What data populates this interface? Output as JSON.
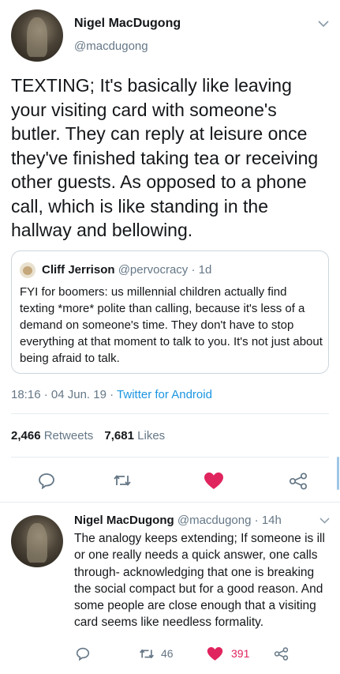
{
  "main_tweet": {
    "display_name": "Nigel MacDugong",
    "handle": "@macdugong",
    "text": "TEXTING; It's basically like leaving your visiting card with someone's butler. They can reply at leisure once they've finished taking tea or receiving other guests. As opposed to a phone call, which is like standing in the hallway and bellowing.",
    "quoted": {
      "display_name": "Cliff Jerrison",
      "handle": "@pervocracy",
      "sep": "·",
      "time": "1d",
      "text": "FYI for boomers: us millennial children actually find texting *more* polite than calling, because it's less of a demand on someone's time. They don't have to stop everything at that moment to talk to you.  It's not just about being afraid to talk."
    },
    "time": "18:16",
    "sep1": "·",
    "date": "04 Jun. 19",
    "sep2": "·",
    "client": "Twitter for Android",
    "retweets_count": "2,466",
    "retweets_label": "Retweets",
    "likes_count": "7,681",
    "likes_label": "Likes",
    "liked": true
  },
  "reply": {
    "display_name": "Nigel MacDugong",
    "handle": "@macdugong",
    "sep": "·",
    "time": "14h",
    "text": "The analogy keeps extending; If someone is ill or one really needs a quick answer, one calls through- acknowledging that one is breaking the social compact but for a good reason. And some people are close enough that a visiting card seems like needless formality.",
    "retweet_count": "46",
    "like_count": "391",
    "liked": true
  },
  "colors": {
    "like": "#e0245e",
    "icon": "#657786",
    "link": "#1b95e0"
  }
}
